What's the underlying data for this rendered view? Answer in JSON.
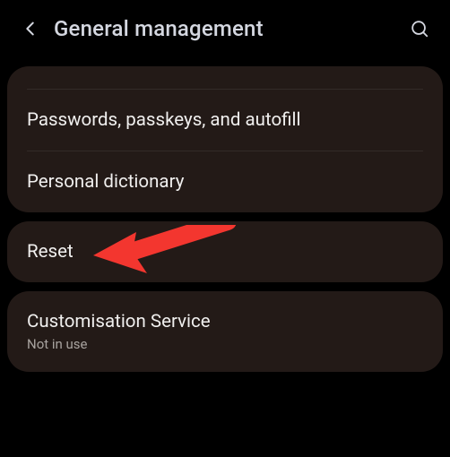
{
  "header": {
    "title": "General management"
  },
  "card1": {
    "items": [
      {
        "label": "Passwords, passkeys, and autofill"
      },
      {
        "label": "Personal dictionary"
      }
    ]
  },
  "card2": {
    "items": [
      {
        "label": "Reset"
      }
    ]
  },
  "card3": {
    "items": [
      {
        "label": "Customisation Service",
        "sub": "Not in use"
      }
    ]
  },
  "annotation": {
    "arrow_color": "#f3362f"
  }
}
